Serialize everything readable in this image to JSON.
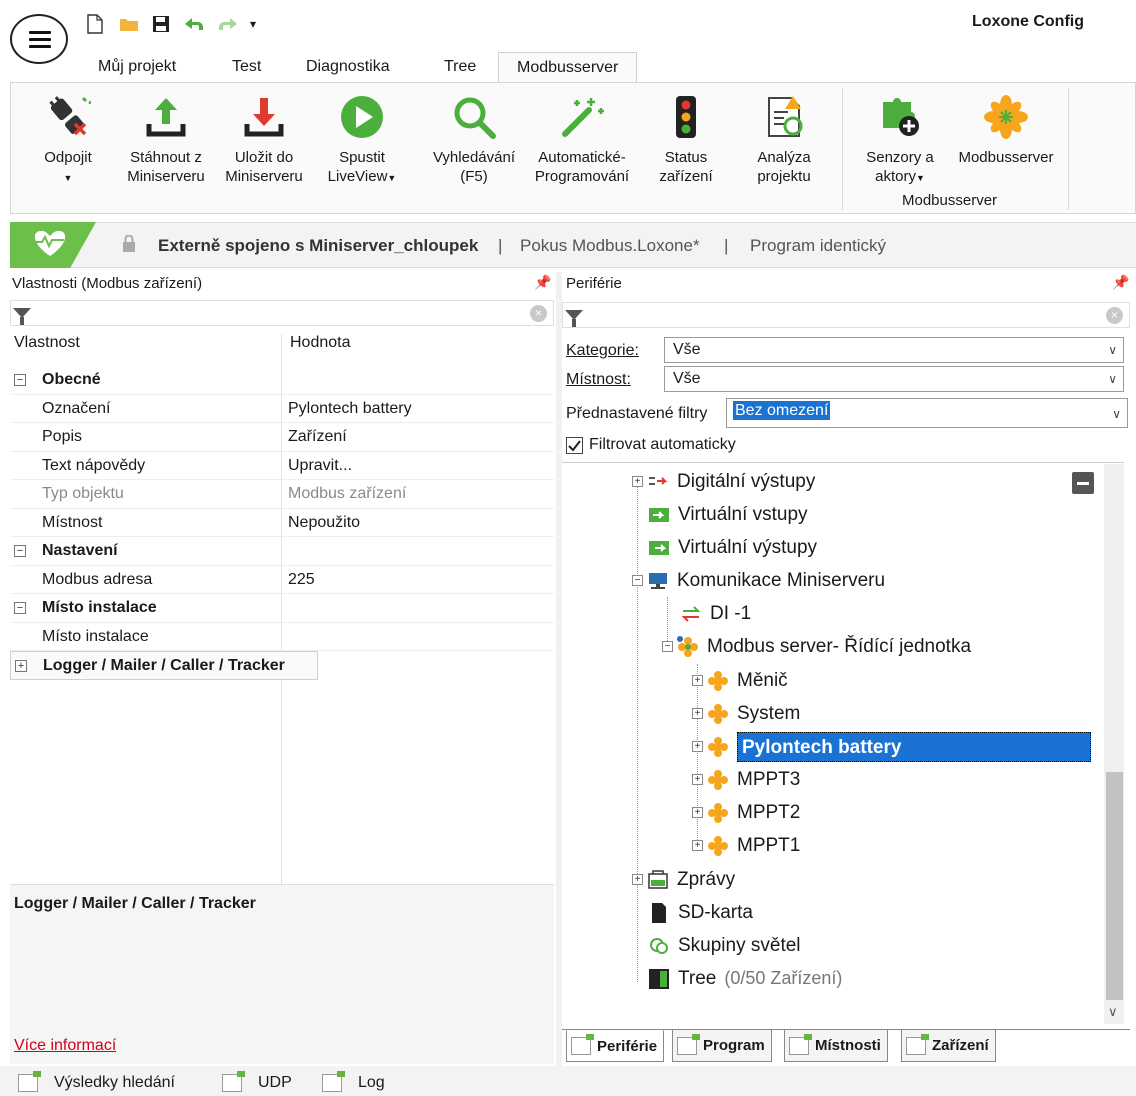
{
  "app": {
    "title": "Loxone Config"
  },
  "quick_access": {
    "new_icon": "new-file-icon",
    "open_icon": "folder-icon",
    "save_icon": "save-icon",
    "undo_icon": "undo-icon",
    "redo_icon": "redo-icon",
    "more_icon": "chevron-down-icon"
  },
  "tabs": [
    "Můj projekt",
    "Test",
    "Diagnostika",
    "Tree",
    "Modbusserver"
  ],
  "ribbon": {
    "buttons": [
      {
        "label": "Odpojit",
        "icon": "disconnect-icon",
        "has_dropdown": true
      },
      {
        "label": "Stáhnout z\nMiniserveru",
        "icon": "upload-icon"
      },
      {
        "label": "Uložit do\nMiniserveru",
        "icon": "download-icon"
      },
      {
        "label": "Spustit\nLiveView",
        "icon": "play-icon",
        "has_dropdown": true
      },
      {
        "label": "Vyhledávání\n(F5)",
        "icon": "search-icon"
      },
      {
        "label": "Automatické-\nProgramování",
        "icon": "magic-wand-icon"
      },
      {
        "label": "Status\nzařízení",
        "icon": "traffic-light-icon"
      },
      {
        "label": "Analýza\nprojektu",
        "icon": "analysis-icon"
      },
      {
        "label": "Senzory a\naktory",
        "icon": "puzzle-add-icon",
        "has_dropdown": true
      },
      {
        "label": "Modbusserver",
        "icon": "modbus-icon"
      }
    ],
    "group_label": "Modbusserver"
  },
  "status": {
    "connection": "Externě spojeno s Miniserver_chloupek",
    "separator": "|",
    "project": "Pokus Modbus.Loxone*",
    "program": "Program identický",
    "color": "#6cc04a"
  },
  "properties": {
    "title": "Vlastnosti (Modbus zařízení)",
    "col_name": "Vlastnost",
    "col_value": "Hodnota",
    "rows": [
      {
        "type": "group",
        "name": "Obecné",
        "expander": "⊟"
      },
      {
        "type": "item",
        "name": "Označení",
        "value": "Pylontech battery"
      },
      {
        "type": "item",
        "name": "Popis",
        "value": "Zařízení"
      },
      {
        "type": "item",
        "name": "Text nápovědy",
        "value": "Upravit..."
      },
      {
        "type": "item",
        "name": "Typ objektu",
        "value": "Modbus zařízení",
        "disabled": true
      },
      {
        "type": "item",
        "name": "Místnost",
        "value": "Nepoužito"
      },
      {
        "type": "group",
        "name": "Nastavení",
        "expander": "⊟"
      },
      {
        "type": "item",
        "name": "Modbus adresa",
        "value": "225"
      },
      {
        "type": "group",
        "name": "Místo instalace",
        "expander": "⊟"
      },
      {
        "type": "item",
        "name": "Místo instalace",
        "value": ""
      },
      {
        "type": "group",
        "name": "Logger / Mailer / Caller / Tracker",
        "expander": "⊞"
      }
    ],
    "help_title": "Logger / Mailer / Caller / Tracker",
    "more_info": "Více informací"
  },
  "periphery": {
    "title": "Periférie",
    "category_label": "Kategorie:",
    "category_value": "Vše",
    "room_label": "Místnost:",
    "room_value": "Vše",
    "preset_label": "Přednastavené filtry",
    "preset_value": "Bez omezení",
    "auto_filter_label": "Filtrovat automaticky",
    "auto_filter_checked": true,
    "tree": [
      {
        "label": "Digitální výstupy",
        "level": 0,
        "expander": "⊞",
        "icon": "digital-output-icon"
      },
      {
        "label": "Virtuální vstupy",
        "level": 0,
        "icon": "virtual-input-icon"
      },
      {
        "label": "Virtuální výstupy",
        "level": 0,
        "icon": "virtual-output-icon"
      },
      {
        "label": "Komunikace Miniserveru",
        "level": 0,
        "expander": "⊟",
        "icon": "network-icon"
      },
      {
        "label": "DI -1",
        "level": 1,
        "icon": "exchange-icon"
      },
      {
        "label": "Modbus server- Řídící jednotka",
        "level": 1,
        "expander": "⊟",
        "icon": "modbus-icon"
      },
      {
        "label": "Měnič",
        "level": 2,
        "expander": "⊞",
        "icon": "modbus-device-icon"
      },
      {
        "label": "System",
        "level": 2,
        "expander": "⊞",
        "icon": "modbus-device-icon"
      },
      {
        "label": "Pylontech battery",
        "level": 2,
        "expander": "⊞",
        "icon": "modbus-device-icon",
        "selected": true
      },
      {
        "label": "MPPT3",
        "level": 2,
        "expander": "⊞",
        "icon": "modbus-device-icon"
      },
      {
        "label": "MPPT2",
        "level": 2,
        "expander": "⊞",
        "icon": "modbus-device-icon"
      },
      {
        "label": "MPPT1",
        "level": 2,
        "expander": "⊞",
        "icon": "modbus-device-icon"
      },
      {
        "label": "Zprávy",
        "level": 0,
        "expander": "⊞",
        "icon": "log-icon"
      },
      {
        "label": "SD-karta",
        "level": 0,
        "icon": "sd-card-icon"
      },
      {
        "label": "Skupiny světel",
        "level": 0,
        "icon": "light-group-icon"
      },
      {
        "label": "Tree",
        "level": 0,
        "icon": "tree-icon",
        "note": "(0/50 Zařízení)"
      }
    ],
    "bottom_tabs": [
      "Periférie",
      "Program",
      "Místnosti",
      "Zařízení"
    ]
  },
  "footer_tabs": [
    "Výsledky hledání",
    "UDP",
    "Log"
  ],
  "colors": {
    "accent": "#6cc04a",
    "selection": "#1a73d2",
    "link": "#d0021b",
    "icon_orange": "#f7a51c"
  }
}
